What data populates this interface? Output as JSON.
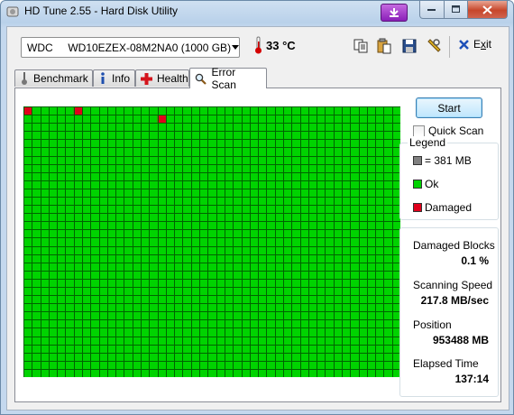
{
  "window": {
    "title": "HD Tune 2.55 - Hard Disk Utility"
  },
  "drive": {
    "selected": "WDC     WD10EZEX-08M2NA0 (1000 GB)"
  },
  "temperature": {
    "value": "33 °C"
  },
  "toolbar": {
    "exit_label": "Exit",
    "exit_mnemonic": "x"
  },
  "tabs": [
    {
      "label": "Benchmark"
    },
    {
      "label": "Info"
    },
    {
      "label": "Health"
    },
    {
      "label": "Error Scan",
      "active": true
    }
  ],
  "scan": {
    "start_label": "Start",
    "quick_scan_label": "Quick Scan",
    "quick_scan_checked": false,
    "grid": {
      "cols": 45,
      "rows": 33,
      "damaged_blocks": [
        [
          0,
          0
        ],
        [
          6,
          0
        ],
        [
          16,
          1
        ]
      ]
    },
    "colors": {
      "ok": "#00d300",
      "damaged": "#e0001c",
      "grid_line": "#006400",
      "unscanned": "#808080"
    }
  },
  "legend": {
    "title": "Legend",
    "items": [
      {
        "label": "= 381 MB",
        "color": "#808080"
      },
      {
        "label": "Ok",
        "color": "#00d300"
      },
      {
        "label": "Damaged",
        "color": "#e0001c"
      }
    ]
  },
  "stats": {
    "damaged_blocks_label": "Damaged Blocks",
    "damaged_blocks_value": "0.1 %",
    "scanning_speed_label": "Scanning Speed",
    "scanning_speed_value": "217.8 MB/sec",
    "position_label": "Position",
    "position_value": "953488 MB",
    "elapsed_label": "Elapsed Time",
    "elapsed_value": "137:14"
  }
}
